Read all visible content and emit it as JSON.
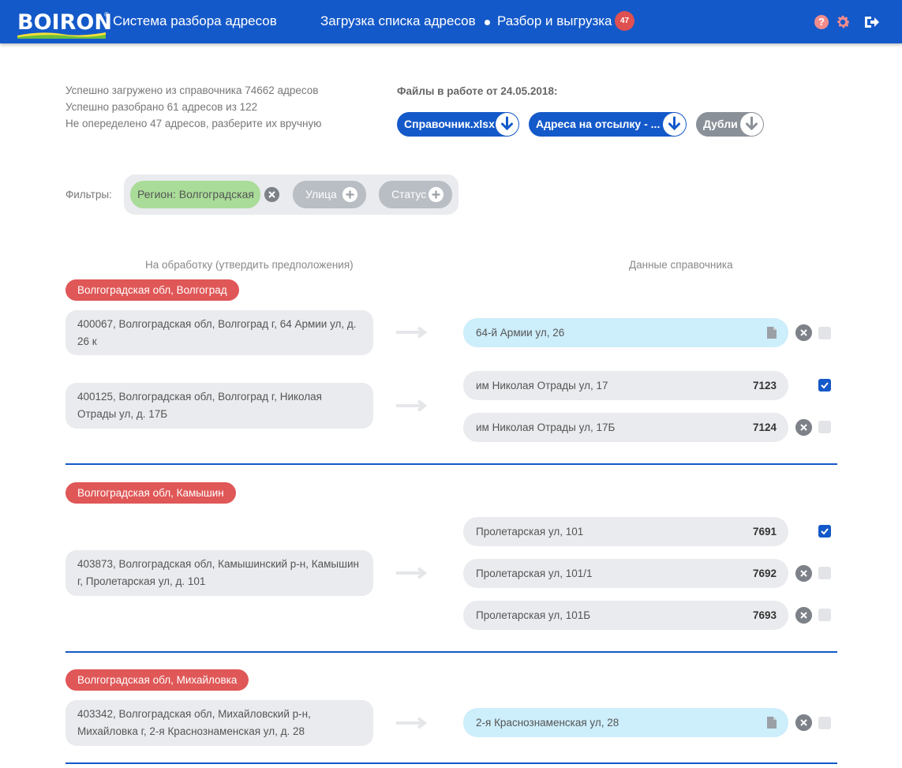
{
  "header": {
    "logo_text": "BOIRON",
    "logo_reg": "®",
    "app_title": "Система разбора адресов",
    "nav": [
      {
        "label": "Загрузка списка адресов"
      },
      {
        "label": "Разбор и выгрузка",
        "badge": "47"
      }
    ],
    "help_icon": "?",
    "icons": [
      "help-icon",
      "gear-icon",
      "logout-icon"
    ]
  },
  "stats": {
    "lines": [
      "Успешно загружено из справочника 74662 адресов",
      "Успешно разобрано 61 адресов из 122",
      "Не опеределено 47 адресов, разберите их вручную"
    ]
  },
  "files": {
    "title": "Файлы в работе от 24.05.2018:",
    "buttons": [
      {
        "label": "Справочник.xlsx",
        "color": "#1459c9"
      },
      {
        "label": "Адреса на отсылку - ...",
        "color": "#1459c9"
      },
      {
        "label": "Дубли",
        "color": "#8a9097"
      }
    ]
  },
  "filters": {
    "label": "Фильтры:",
    "active": "Регион:  Волгоградская",
    "available": [
      "Улица",
      "Статус"
    ]
  },
  "columns": {
    "left": "На обработку (утвердить предположения)",
    "right": "Данные справочника"
  },
  "groups": [
    {
      "region": "Волгоградская обл, Волгоград",
      "items": [
        {
          "source": "400067, Волгоградская обл, Волгоград г, 64 Армии ул, д. 26 к",
          "candidates": [
            {
              "text": "64-й Армии ул, 26",
              "code": "",
              "doc": true,
              "checked": false
            }
          ]
        },
        {
          "source": "400125, Волгоградская обл, Волгоград г, Николая Отрады ул, д. 17Б",
          "candidates": [
            {
              "text": "им Николая Отрады ул, 17",
              "code": "7123",
              "checked": true
            },
            {
              "text": "им Николая Отрады ул, 17Б",
              "code": "7124",
              "checked": false
            }
          ]
        }
      ]
    },
    {
      "region": "Волгоградская обл, Камышин",
      "items": [
        {
          "source": "403873, Волгоградская обл, Камышинский р-н, Камышин г, Пролетарская ул, д. 101",
          "candidates": [
            {
              "text": "Пролетарская ул, 101",
              "code": "7691",
              "checked": true
            },
            {
              "text": "Пролетарская ул, 101/1",
              "code": "7692",
              "checked": false
            },
            {
              "text": "Пролетарская ул, 101Б",
              "code": "7693",
              "checked": false
            }
          ]
        }
      ]
    },
    {
      "region": "Волгоградская обл, Михайловка",
      "items": [
        {
          "source": "403342, Волгоградская обл, Михайловский р-н, Михайловка г, 2-я Краснознаменская ул, д. 28",
          "candidates": [
            {
              "text": "2-я Краснознаменская ул, 28",
              "code": "",
              "doc": true,
              "checked": false
            }
          ]
        }
      ]
    }
  ]
}
